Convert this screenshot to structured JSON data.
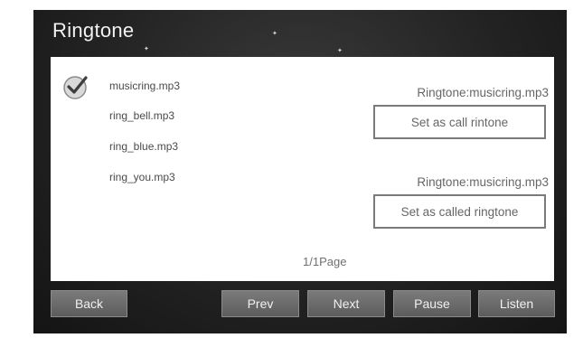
{
  "header": {
    "title": "Ringtone"
  },
  "files": [
    {
      "name": "musicring.mp3",
      "selected": true
    },
    {
      "name": "ring_bell.mp3",
      "selected": false
    },
    {
      "name": "ring_blue.mp3",
      "selected": false
    },
    {
      "name": "ring_you.mp3",
      "selected": false
    }
  ],
  "call_ringtone": {
    "label": "Ringtone:musicring.mp3",
    "button": "Set as call rintone"
  },
  "called_ringtone": {
    "label": "Ringtone:musicring.mp3",
    "button": "Set as called ringtone"
  },
  "pagination": {
    "text": "1/1Page"
  },
  "buttons": {
    "back": "Back",
    "prev": "Prev",
    "next": "Next",
    "pause": "Pause",
    "listen": "Listen"
  },
  "icons": {
    "selected": "checkmark-circle-icon",
    "sparkle": "star-sparkle-icon"
  }
}
